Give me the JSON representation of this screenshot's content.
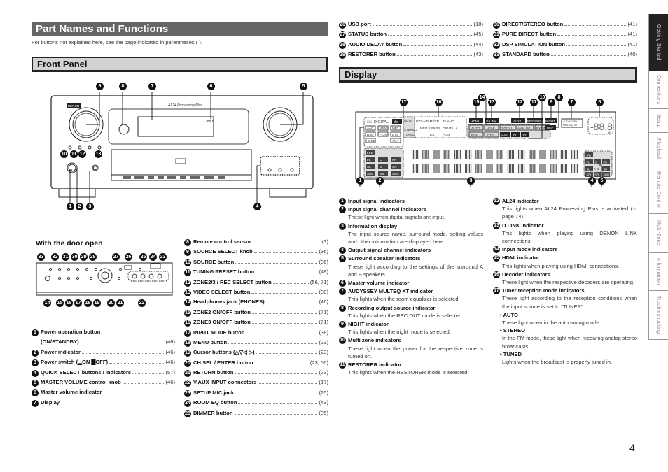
{
  "page": {
    "title": "Part Names and Functions",
    "intro": "For buttons not explained here, see the page indicated in parentheses ( ).",
    "page_number": "4"
  },
  "side_tabs": [
    {
      "label": "Getting Started",
      "active": true
    },
    {
      "label": "Connections",
      "active": false
    },
    {
      "label": "Setup",
      "active": false
    },
    {
      "label": "Playback",
      "active": false
    },
    {
      "label": "Remote Control",
      "active": false
    },
    {
      "label": "Multi-Zone",
      "active": false
    },
    {
      "label": "Information",
      "active": false
    },
    {
      "label": "Troubleshooting",
      "active": false
    }
  ],
  "front_panel": {
    "heading": "Front Panel",
    "door_open_heading": "With the door open",
    "brand_label": "DENON",
    "display_caption": "AL24 Processing Plus",
    "volume_readout": "-88.8",
    "markers_top": [
      "9",
      "8",
      "7",
      "6",
      "5"
    ],
    "markers_bottom": [
      "1",
      "2",
      "3",
      "4"
    ],
    "markers_mid": [
      "10",
      "11",
      "12",
      "13"
    ],
    "door_markers_top": [
      "33",
      "32",
      "31",
      "30",
      "29",
      "28",
      "27",
      "26",
      "25",
      "24",
      "23"
    ],
    "door_markers_bottom": [
      "14",
      "15",
      "16",
      "17",
      "18",
      "19",
      "20",
      "21",
      "22"
    ],
    "items_left": [
      {
        "n": "1",
        "label": "Power  operation button",
        "label2": "(ON/STANDBY)",
        "page": "(46)"
      },
      {
        "n": "2",
        "label": "Power indicator",
        "page": "(46)"
      },
      {
        "n": "3",
        "label": "Power switch (▂ON ▇OFF)",
        "page": "(46)"
      },
      {
        "n": "4",
        "label": "QUICK SELECT buttons / indicators",
        "page": "(57)"
      },
      {
        "n": "5",
        "label": "MASTER VOLUME control knob",
        "page": "(46)"
      },
      {
        "n": "6",
        "label": "Master volume indicator",
        "page": ""
      },
      {
        "n": "7",
        "label": "Display",
        "page": ""
      }
    ],
    "items_mid": [
      {
        "n": "8",
        "label": "Remote control sensor",
        "page": "(3)"
      },
      {
        "n": "9",
        "label": "SOURCE SELECT knob",
        "page": "(36)"
      },
      {
        "n": "10",
        "label": "SOURCE button",
        "page": "(36)"
      },
      {
        "n": "11",
        "label": "TUNING PRESET button",
        "page": "(48)"
      },
      {
        "n": "12",
        "label": "ZONE2/3 / REC SELECT button",
        "page": "(56, 71)"
      },
      {
        "n": "13",
        "label": "VIDEO SELECT button",
        "page": "(38)"
      },
      {
        "n": "14",
        "label": "Headphones jack (PHONES)",
        "page": "(46)"
      },
      {
        "n": "15",
        "label": "ZONE2 ON/OFF button",
        "page": "(71)"
      },
      {
        "n": "16",
        "label": "ZONE3 ON/OFF button",
        "page": "(71)"
      },
      {
        "n": "17",
        "label": "INPUT MODE button",
        "page": "(38)"
      },
      {
        "n": "18",
        "label": "MENU button",
        "page": "(23)"
      },
      {
        "n": "19",
        "label": "Cursor buttons (△▽◁ ▷)",
        "page": "(23)"
      },
      {
        "n": "20",
        "label": "CH SEL / ENTER button",
        "page": "(23, 56)"
      },
      {
        "n": "21",
        "label": "RETURN button",
        "page": "(23)"
      },
      {
        "n": "22",
        "label": "V.AUX INPUT connectors",
        "page": "(17)"
      },
      {
        "n": "23",
        "label": "SETUP MIC jack",
        "page": "(25)"
      },
      {
        "n": "24",
        "label": "ROOM EQ button",
        "page": "(43)"
      },
      {
        "n": "25",
        "label": "DIMMER button",
        "page": "(35)"
      }
    ],
    "items_top_a": [
      {
        "n": "26",
        "label": "USB port",
        "page": "(18)"
      },
      {
        "n": "27",
        "label": "STATUS button",
        "page": "(45)"
      },
      {
        "n": "28",
        "label": "AUDIO DELAY button",
        "page": "(44)"
      },
      {
        "n": "29",
        "label": "RESTORER button",
        "page": "(43)"
      }
    ],
    "items_top_b": [
      {
        "n": "30",
        "label": "DIRECT/STEREO button",
        "page": "(41)"
      },
      {
        "n": "31",
        "label": "PURE DIRECT button",
        "page": "(41)"
      },
      {
        "n": "32",
        "label": "DSP SIMULATION button",
        "page": "(41)"
      },
      {
        "n": "33",
        "label": "STANDARD button",
        "page": "(40)"
      }
    ]
  },
  "display": {
    "heading": "Display",
    "markers_top": [
      "17",
      "16",
      "15",
      "14",
      "13",
      "12",
      "11",
      "10",
      "9",
      "8",
      "7",
      "6"
    ],
    "markers_bottom": [
      "1",
      "2",
      "3",
      "4",
      "5"
    ],
    "input_indicators": [
      "DIGITAL",
      "dts",
      "AAC",
      "WMA",
      "MP3",
      "DSD",
      "PCM",
      "DTS",
      "HDCD",
      "ANA"
    ],
    "tuner_indicators": [
      "AUTO",
      "STEREO",
      "TUNED"
    ],
    "decoder_indicators": [
      "DTS-HD MSTR",
      "TrueHD",
      "NEO:6",
      "96/24",
      "DIGITAL+",
      "ES",
      "PLIIx"
    ],
    "input_mode_indicators": [
      "HDMI",
      "D.LINK",
      "AUTO",
      "HDMI",
      "DIGITAL",
      "ANALOG",
      "EXT.IN",
      "PCM",
      "DTS"
    ],
    "zone_indicators": [
      "MAN",
      "Z2",
      "Z3"
    ],
    "status_indicators": [
      "AL24",
      "RESTORER",
      "NIGHT",
      "REC",
      "AUDYSSEY MULTEQ XT"
    ],
    "volume_readout": "-88.8",
    "volume_unit": "dB",
    "input_channels": [
      "LFE",
      "FL",
      "C",
      "FR",
      "SL",
      "S",
      "SR",
      "SBL",
      "SB",
      "SBR"
    ],
    "output_channels": [
      "SW",
      "FL",
      "C",
      "FR",
      "SL",
      "SR",
      "SBL",
      "SB",
      "SBR"
    ],
    "speaker_ab": "A B",
    "items_left": [
      {
        "n": "1",
        "head": "Input signal indicators",
        "text": ""
      },
      {
        "n": "2",
        "head": "Input signal channel indicators",
        "text": "These light when digital signals are input."
      },
      {
        "n": "3",
        "head": "Information display",
        "text": "The input source name, surround mode, setting values and other information are displayed here."
      },
      {
        "n": "4",
        "head": "Output signal channel indicators",
        "text": ""
      },
      {
        "n": "5",
        "head": "Surround speaker indicators",
        "text": "These light according to the settings of the surround A and B speakers."
      },
      {
        "n": "6",
        "head": "Master volume indicator",
        "text": ""
      },
      {
        "n": "7",
        "head": "AUDYSSEY MULTEQ XT indicator",
        "text": "This lights when the room equalizer is selected."
      },
      {
        "n": "8",
        "head": "Recording output source indicator",
        "text": "This lights when the REC OUT mode is selected."
      },
      {
        "n": "9",
        "head": "NIGHT indicator",
        "text": "This lights when the night mode is selected."
      },
      {
        "n": "10",
        "head": "Multi zone indicators",
        "text": "These light when the power for the respective zone is turned on."
      },
      {
        "n": "11",
        "head": "RESTORER indicator",
        "text": "This lights when the RESTORER mode is selected."
      }
    ],
    "items_right": [
      {
        "n": "12",
        "head": "AL24 indicator",
        "text": "This lights when AL24 Processing Plus is activated (☞ page 74)."
      },
      {
        "n": "13",
        "head": "D.LINK indicator",
        "text": "This lights when playing using DENON LINK connections."
      },
      {
        "n": "14",
        "head": "Input mode indicators",
        "text": ""
      },
      {
        "n": "15",
        "head": "HDMI indicator",
        "text": "This lights when playing using HDMI connections."
      },
      {
        "n": "16",
        "head": "Decoder indicators",
        "text": "These light when the respective decoders are operating."
      },
      {
        "n": "17",
        "head": "Tuner reception mode indicators",
        "text": "These light according to the reception conditions when the input source is set to “TUNER”."
      }
    ],
    "tuner_sub": [
      {
        "head": "• AUTO",
        "text": "These light when in the auto tuning mode."
      },
      {
        "head": "• STEREO",
        "text": "In the FM mode, these light when receiving analog stereo broadcasts."
      },
      {
        "head": "• TUNED",
        "text": "Lights when the broadcast is properly tuned in."
      }
    ]
  }
}
